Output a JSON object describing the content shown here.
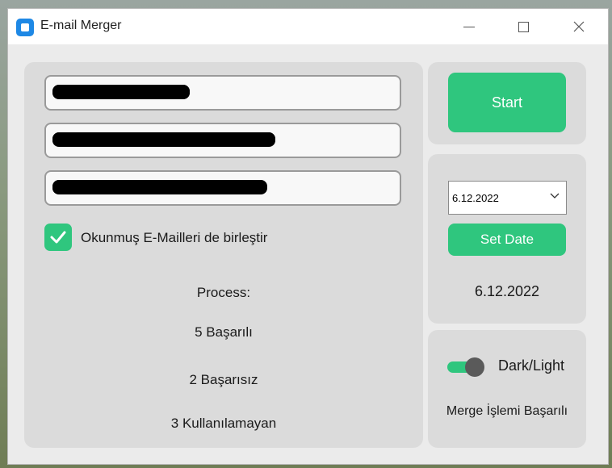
{
  "window": {
    "title": "E-mail Merger"
  },
  "fields": [
    {
      "value": "████████████████"
    },
    {
      "value": "██████████████████████████"
    },
    {
      "value": "█████████████████████████"
    }
  ],
  "checkbox": {
    "label": "Okunmuş E-Mailleri de birleştir",
    "checked": true
  },
  "process": {
    "heading": "Process:",
    "success": "5 Başarılı",
    "failed": "2 Başarısız",
    "unusable": "3 Kullanılamayan"
  },
  "start": {
    "label": "Start"
  },
  "date": {
    "selected": "6.12.2022",
    "set_label": "Set Date",
    "display": "6.12.2022"
  },
  "theme": {
    "label": "Dark/Light",
    "toggled": true
  },
  "status": {
    "message": "Merge İşlemi Başarılı"
  },
  "colors": {
    "accent": "#2fc67e",
    "panel": "#dbdbdb",
    "window_bg": "#ebebeb"
  }
}
